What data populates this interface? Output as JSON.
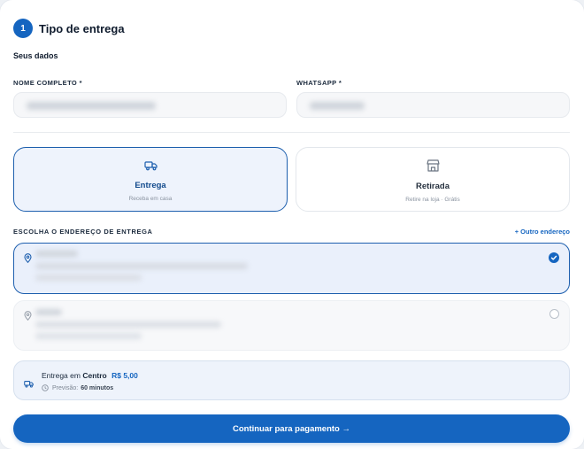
{
  "step": {
    "number": "1",
    "title": "Tipo de entrega"
  },
  "section": {
    "subtitle": "Seus dados"
  },
  "fields": {
    "name_label": "NOME COMPLETO *",
    "whatsapp_label": "WHATSAPP *"
  },
  "delivery_options": [
    {
      "title": "Entrega",
      "subtitle": "Receba em casa",
      "icon": "truck-icon",
      "selected": true
    },
    {
      "title": "Retirada",
      "subtitle": "Retire na loja · Grátis",
      "icon": "store-icon",
      "selected": false
    }
  ],
  "address": {
    "heading": "ESCOLHA O ENDEREÇO DE ENTREGA",
    "add_link": "+ Outro endereço"
  },
  "summary": {
    "prefix": "Entrega em",
    "location": "Centro",
    "price": "R$ 5,00",
    "eta_label": "Previsão:",
    "eta_value": "60 minutos"
  },
  "cta": {
    "label": "Continuar para pagamento →"
  },
  "colors": {
    "primary": "#1565c0",
    "selected_bg": "#eef3fc"
  }
}
